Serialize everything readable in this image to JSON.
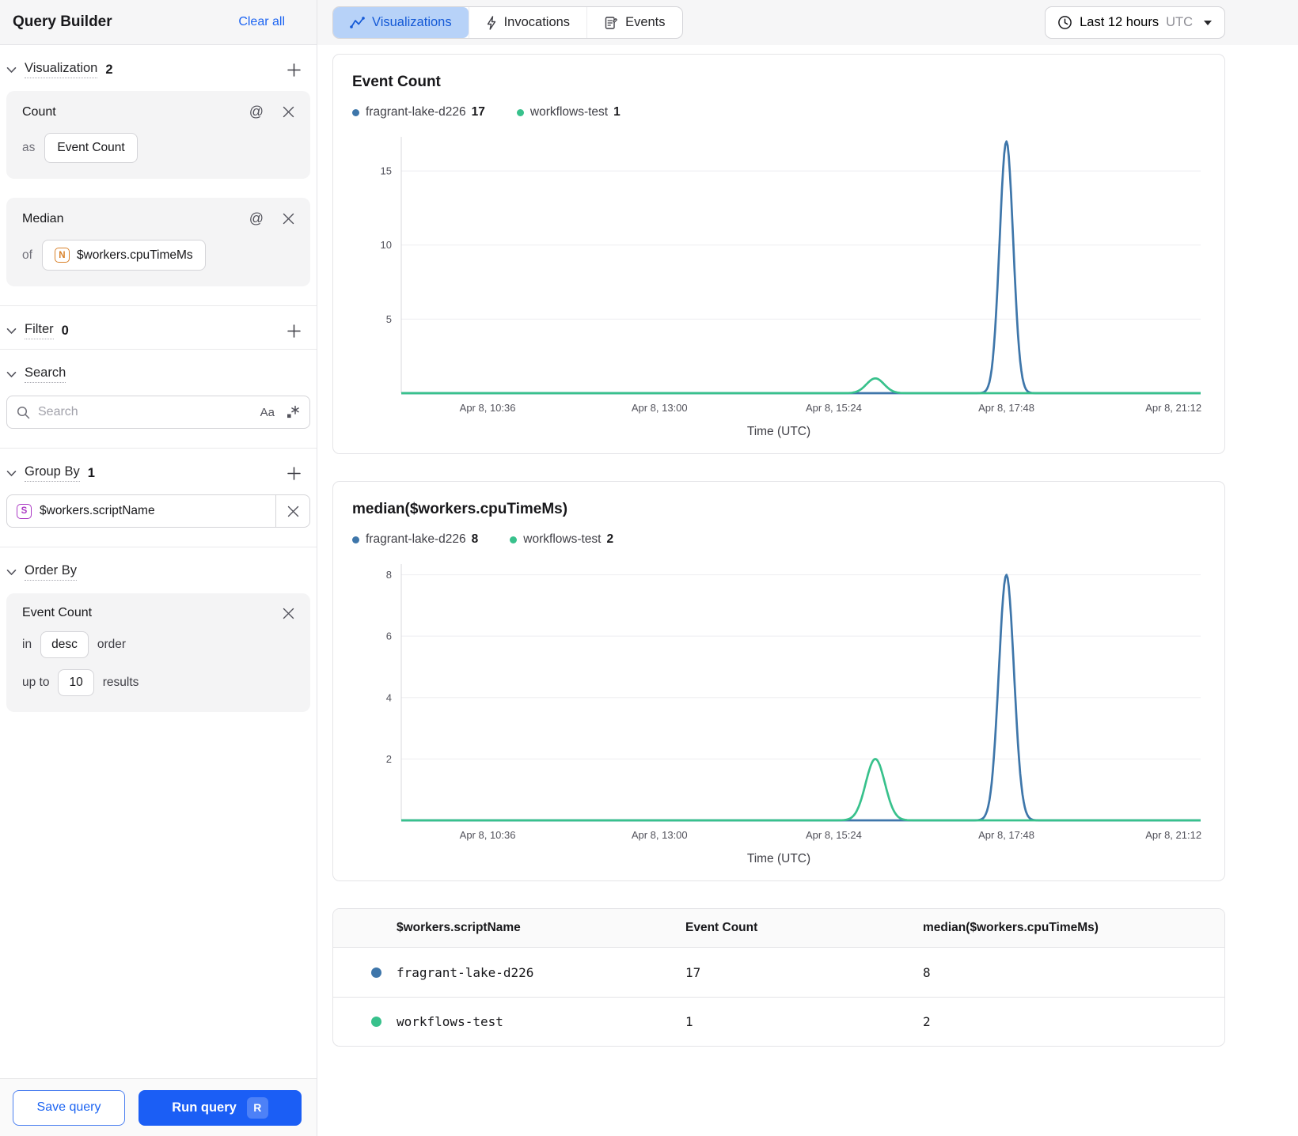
{
  "sidebar": {
    "title": "Query Builder",
    "clear_all": "Clear all",
    "sections": {
      "visualization": {
        "label": "Visualization",
        "count": "2"
      },
      "filter": {
        "label": "Filter",
        "count": "0"
      },
      "search": {
        "label": "Search"
      },
      "group_by": {
        "label": "Group By",
        "count": "1"
      },
      "order_by": {
        "label": "Order By"
      }
    },
    "visualization_cards": [
      {
        "title": "Count",
        "prefix": "as",
        "value": "Event Count"
      },
      {
        "title": "Median",
        "prefix": "of",
        "value": "$workers.cpuTimeMs",
        "field_type_badge": "N"
      }
    ],
    "search": {
      "placeholder": "Search",
      "match_case_label": "Aa"
    },
    "group_by_chip": {
      "field_type_badge": "S",
      "value": "$workers.scriptName"
    },
    "order_by": {
      "field": "Event Count",
      "in_label": "in",
      "direction": "desc",
      "order_label": "order",
      "up_to_label": "up to",
      "limit": "10",
      "results_label": "results"
    },
    "footer": {
      "save_label": "Save query",
      "run_label": "Run query",
      "run_shortcut": "R"
    }
  },
  "topbar": {
    "tabs": [
      {
        "label": "Visualizations",
        "active": true
      },
      {
        "label": "Invocations",
        "active": false
      },
      {
        "label": "Events",
        "active": false
      }
    ],
    "time_range": {
      "label": "Last 12 hours",
      "timezone": "UTC"
    }
  },
  "chart_data": [
    {
      "type": "line",
      "title": "Event Count",
      "xlabel": "Time (UTC)",
      "x_ticks": [
        "Apr 8, 10:36",
        "Apr 8, 13:00",
        "Apr 8, 15:24",
        "Apr 8, 17:48",
        "Apr 8, 21:12"
      ],
      "x_tick_fractions": [
        0.108,
        0.323,
        0.541,
        0.757,
        0.966
      ],
      "y_ticks": [
        5,
        10,
        15
      ],
      "ylim": [
        0,
        17.3
      ],
      "grid": true,
      "legend_position": "top",
      "series": [
        {
          "name": "fragrant-lake-d226",
          "total": 17,
          "color": "#3e76aa",
          "baseline": 0,
          "peaks": [
            {
              "center_fraction": 0.757,
              "near_time": "Apr 8, 17:48",
              "value": 17,
              "sigma": 0.0085
            }
          ]
        },
        {
          "name": "workflows-test",
          "total": 1,
          "color": "#38c18c",
          "baseline": 0,
          "peaks": [
            {
              "center_fraction": 0.593,
              "near_time": "Apr 8, 16:00",
              "value": 1,
              "sigma": 0.011
            }
          ]
        }
      ]
    },
    {
      "type": "line",
      "title": "median($workers.cpuTimeMs)",
      "xlabel": "Time (UTC)",
      "x_ticks": [
        "Apr 8, 10:36",
        "Apr 8, 13:00",
        "Apr 8, 15:24",
        "Apr 8, 17:48",
        "Apr 8, 21:12"
      ],
      "x_tick_fractions": [
        0.108,
        0.323,
        0.541,
        0.757,
        0.966
      ],
      "y_ticks": [
        2,
        4,
        6,
        8
      ],
      "ylim": [
        0,
        8.35
      ],
      "grid": true,
      "legend_position": "top",
      "series": [
        {
          "name": "fragrant-lake-d226",
          "total": 8,
          "color": "#3e76aa",
          "baseline": 0,
          "peaks": [
            {
              "center_fraction": 0.757,
              "near_time": "Apr 8, 17:48",
              "value": 8,
              "sigma": 0.0095
            }
          ]
        },
        {
          "name": "workflows-test",
          "total": 2,
          "color": "#38c18c",
          "baseline": 0,
          "peaks": [
            {
              "center_fraction": 0.593,
              "near_time": "Apr 8, 16:00",
              "value": 2,
              "sigma": 0.012
            }
          ]
        }
      ]
    }
  ],
  "table": {
    "headers": [
      "$workers.scriptName",
      "Event Count",
      "median($workers.cpuTimeMs)"
    ],
    "rows": [
      {
        "color": "#3e76aa",
        "script_name": "fragrant-lake-d226",
        "event_count": "17",
        "median_cpu_time": "8"
      },
      {
        "color": "#38c18c",
        "script_name": "workflows-test",
        "event_count": "1",
        "median_cpu_time": "2"
      }
    ]
  },
  "colors": {
    "accent_blue": "#1c64f2",
    "active_tab_bg": "#b7d2f8",
    "active_tab_text": "#1459d6",
    "series_blue": "#3e76aa",
    "series_green": "#38c18c",
    "badge_orange": "#d9822b",
    "badge_purple": "#ab39c4"
  }
}
